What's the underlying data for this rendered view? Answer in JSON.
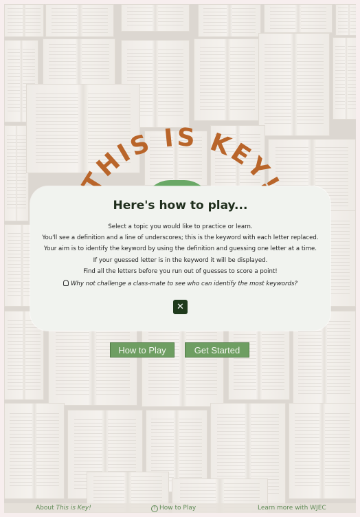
{
  "app": {
    "title_arc": "THIS IS KEY!",
    "accent_color": "#b9652a",
    "button_color": "#6e9e62"
  },
  "buttons": {
    "how_to_play": "How to Play",
    "get_started": "Get Started"
  },
  "modal": {
    "heading": "Here's how to play...",
    "lines": [
      "Select a topic you would like to practice or learn.",
      "You'll see a definition and a line of underscores; this is the keyword with each letter replaced.",
      "Your aim is to identify the keyword by using the definition and guessing one letter at a time.",
      "If your guessed letter is in the keyword it will be displayed.",
      "Find all the letters before you run out of guesses to score a point!"
    ],
    "tip": "Why not challenge a class-mate to see who can identify the most keywords?",
    "tip_icon": "lightbulb-icon",
    "close_icon": "close-icon"
  },
  "footer": {
    "about_prefix": "About ",
    "about_em": "This is Key!",
    "how_to_play": "How to Play",
    "learn_more": "Learn more with WJEC"
  }
}
